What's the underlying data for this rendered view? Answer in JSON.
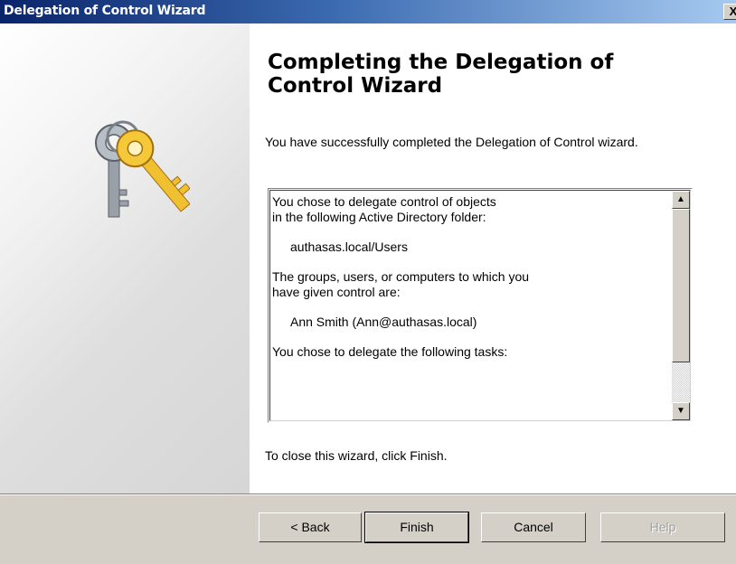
{
  "window": {
    "title": "Delegation of Control Wizard",
    "close_label": "X"
  },
  "content": {
    "heading": "Completing the Delegation of Control Wizard",
    "intro": "You have successfully completed the Delegation of Control wizard.",
    "summary": {
      "line1": "You chose to delegate control of objects",
      "line2": "in the following Active Directory folder:",
      "folder": "authasas.local/Users",
      "line3": "The groups, users, or computers to which you",
      "line4": "have given control are:",
      "principal": "Ann Smith (Ann@authasas.local)",
      "line5": "You chose to delegate the following tasks:"
    },
    "close_hint": "To close this wizard, click Finish."
  },
  "buttons": {
    "back": "< Back",
    "finish": "Finish",
    "cancel": "Cancel",
    "help": "Help"
  },
  "icons": {
    "wizard": "keys-icon",
    "scroll_up": "scroll-up-arrow-icon",
    "scroll_down": "scroll-down-arrow-icon"
  },
  "colors": {
    "titlebar_start": "#0a246a",
    "titlebar_end": "#a6caf0",
    "key_gold": "#e8b020",
    "key_silver": "#9aa0a8",
    "dialog_face": "#d4d0c8"
  }
}
